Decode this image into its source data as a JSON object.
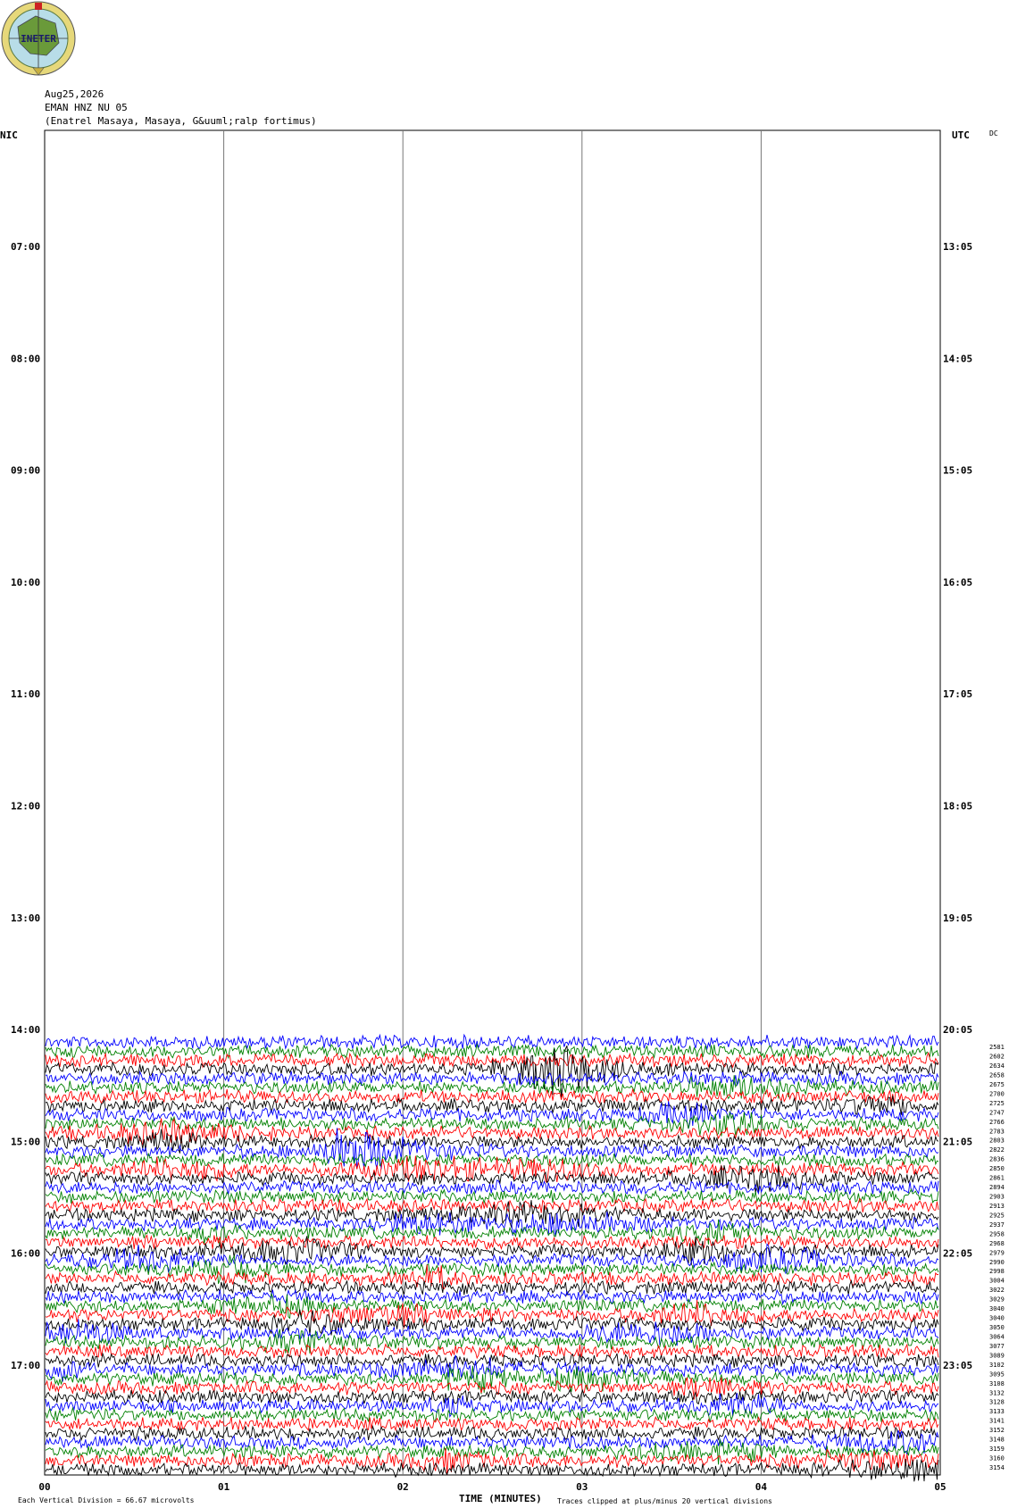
{
  "header": {
    "date": "Aug25,2026",
    "station": "EMAN HNZ NU 05",
    "location": "(Enatrel Masaya, Masaya, G&uuml;ralp fortimus)"
  },
  "logo": {
    "text": "INETER",
    "icon": "ineter-globe-logo"
  },
  "axes": {
    "left_label": "NIC",
    "right_label": "UTC",
    "dc_label": "DC",
    "xlabel": "TIME (MINUTES)"
  },
  "footer": {
    "scale_note": "Each Vertical Division =   66.67 microvolts",
    "clip_note": "Traces clipped at plus/minus 20 vertical divisions"
  },
  "chart_data": {
    "type": "line",
    "title": "",
    "x_ticks": [
      "00",
      "01",
      "02",
      "03",
      "04",
      "05"
    ],
    "left_times": [
      "07:00",
      "08:00",
      "09:00",
      "10:00",
      "11:00",
      "12:00",
      "13:00",
      "14:00",
      "15:00",
      "16:00",
      "17:00"
    ],
    "right_times": [
      "13:05",
      "14:05",
      "15:05",
      "16:05",
      "17:05",
      "18:05",
      "19:05",
      "20:05",
      "21:05",
      "22:05",
      "23:05"
    ],
    "trace_colors": [
      "#0000ff",
      "#008000",
      "#ff0000",
      "#000000"
    ],
    "trace_start": "14:00",
    "trace_count": 48,
    "amplitude_labels": [
      "2581",
      "2602",
      "2634",
      "2658",
      "2675",
      "2700",
      "2725",
      "2747",
      "2766",
      "2783",
      "2803",
      "2822",
      "2836",
      "2850",
      "2861",
      "2894",
      "2903",
      "2913",
      "2925",
      "2937",
      "2958",
      "2968",
      "2979",
      "2990",
      "2998",
      "3004",
      "3022",
      "3029",
      "3040",
      "3040",
      "3050",
      "3064",
      "3077",
      "3089",
      "3102",
      "3095",
      "3108",
      "3132",
      "3128",
      "3133",
      "3141",
      "3152",
      "3148",
      "3159",
      "3160",
      "3154"
    ]
  }
}
